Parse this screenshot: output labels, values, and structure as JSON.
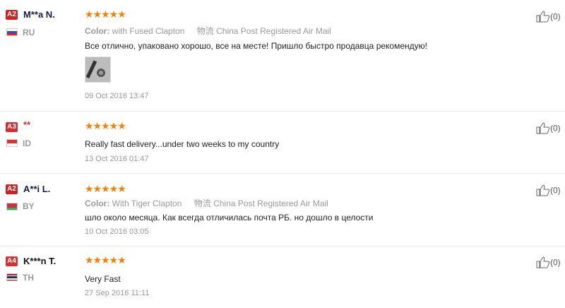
{
  "colors": {
    "star": "#f88000",
    "badge_a2": "#cc2222",
    "badge_a3": "#d62e2e",
    "badge_a4": "#d8322e"
  },
  "reviews": [
    {
      "level": "A2",
      "user": "M**a N.",
      "country": "RU",
      "stars": "★★★★★",
      "color_label": "Color:",
      "color_value": "with Fused Clapton",
      "ship_icon": "物流",
      "ship_value": "China Post Registered Air Mail",
      "text": "Все отлично, упаковано хорошо, все на месте! Пришло быстро продавца рекомендую!",
      "date": "09 Oct 2016 13:47",
      "helpful": "(0)"
    },
    {
      "level": "A3",
      "user": "**",
      "country": "ID",
      "stars": "★★★★★",
      "text": "Really fast delivery...under two weeks to my country",
      "date": "13 Oct 2016 01:47",
      "helpful": "(0)"
    },
    {
      "level": "A2",
      "user": "A**i L.",
      "country": "BY",
      "stars": "★★★★★",
      "color_label": "Color:",
      "color_value": "With Tiger Clapton",
      "ship_icon": "物流",
      "ship_value": "China Post Registered Air Mail",
      "text": "шло около месяца. Как всегда отличилась почта РБ. но дошло в целости",
      "date": "10 Oct 2016 03:05",
      "helpful": "(0)"
    },
    {
      "level": "A4",
      "user": "K***n T.",
      "country": "TH",
      "stars": "★★★★★",
      "text": "Very Fast",
      "date": "27 Sep 2016 11:11",
      "helpful": "(0)"
    }
  ]
}
